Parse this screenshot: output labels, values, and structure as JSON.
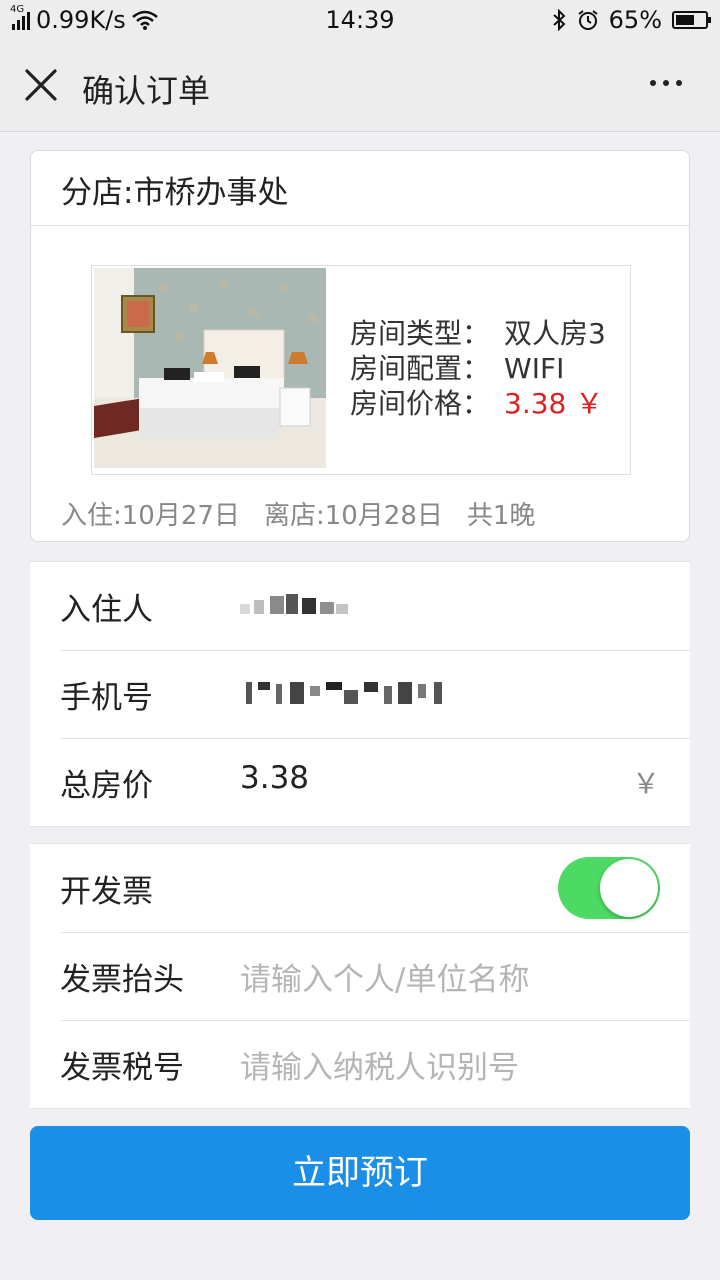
{
  "status": {
    "net_speed": "0.99K/s",
    "network_type": "4G",
    "time": "14:39",
    "battery": "65%",
    "battery_level": 0.65
  },
  "nav": {
    "title": "确认订单",
    "close_icon": "close-icon",
    "more_icon": "more-icon"
  },
  "hotel": {
    "branch": "分店:市桥办事处",
    "room_type_label": "房间类型：",
    "room_type": "双人房3",
    "room_config_label": "房间配置：",
    "room_config": "WIFI",
    "room_price_label": "房间价格：",
    "room_price": "3.38 ￥",
    "check_in": "入住:10月27日",
    "check_out": "离店:10月28日",
    "nights": "共1晚",
    "price_color": "#e02020"
  },
  "guest": {
    "name_label": "入住人",
    "phone_label": "手机号",
    "total_label": "总房价",
    "total_value": "3.38",
    "currency": "￥"
  },
  "invoice": {
    "toggle_label": "开发票",
    "toggle_on": true,
    "title_label": "发票抬头",
    "title_placeholder": "请输入个人/单位名称",
    "tax_label": "发票税号",
    "tax_placeholder": "请输入纳税人识别号",
    "toggle_color": "#4cd964"
  },
  "actions": {
    "book_label": "立即预订",
    "button_color": "#1b8ee8"
  }
}
